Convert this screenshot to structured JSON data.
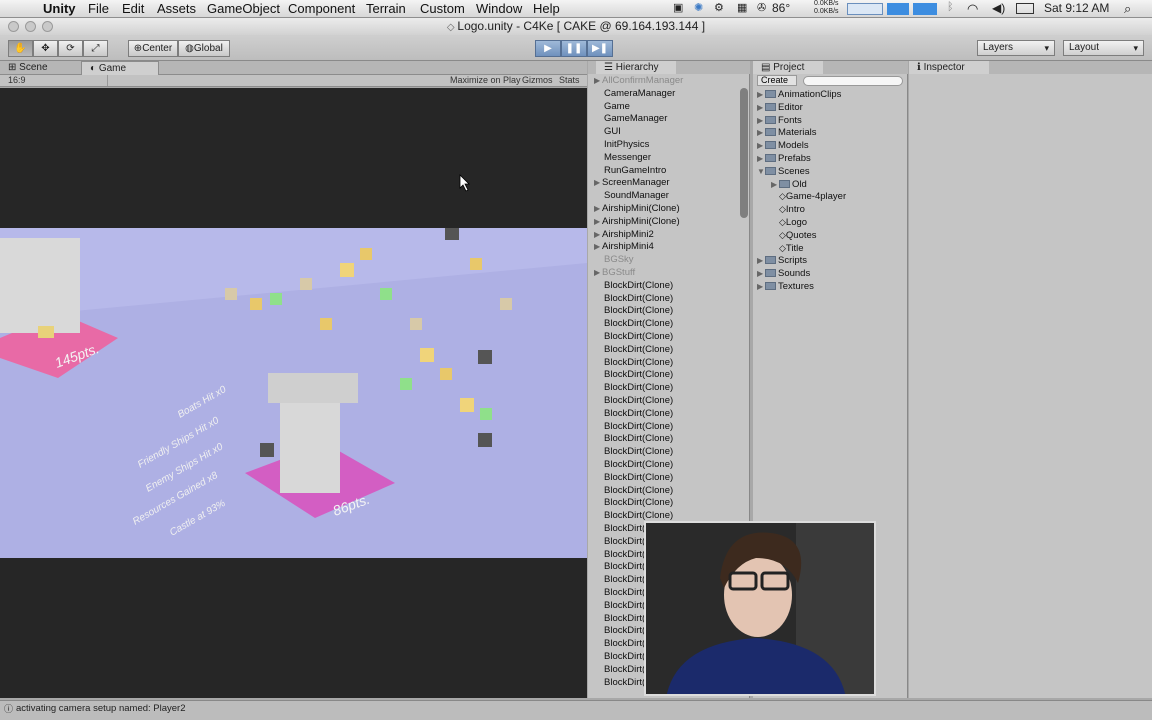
{
  "menubar": {
    "app": "Unity",
    "items": [
      "File",
      "Edit",
      "Assets",
      "GameObject",
      "Component",
      "Terrain",
      "Custom",
      "Window",
      "Help"
    ],
    "temperature": "86°",
    "net_up": "0.0KB/s",
    "net_down": "0.0KB/s",
    "clock": "Sat 9:12 AM"
  },
  "window": {
    "title": "Logo.unity - C4Ke [ CAKE @ 69.164.193.144 ]"
  },
  "toolbar": {
    "pivot_label": "Center",
    "space_label": "Global",
    "play_icon": "play-icon",
    "pause_icon": "pause-icon",
    "step_icon": "step-icon",
    "layers_label": "Layers",
    "layout_label": "Layout"
  },
  "game_panel": {
    "tabs": [
      "Scene",
      "Game"
    ],
    "aspect": "16:9",
    "maximize_label": "Maximize on Play",
    "gizmos_label": "Gizmos",
    "stats_label": "Stats",
    "overlay": {
      "score_left": "145pts.",
      "score_right": "86pts.",
      "stats_lines": [
        "Boats Hit x0",
        "Friendly Ships Hit x0",
        "Enemy Ships Hit x0",
        "Resources Gained x8",
        "Castle at 93%"
      ]
    }
  },
  "hierarchy": {
    "title": "Hierarchy",
    "items": [
      {
        "label": "AllConfirmManager",
        "dim": true,
        "arrow": true
      },
      {
        "label": "CameraManager",
        "dim": false,
        "arrow": false
      },
      {
        "label": "Game",
        "dim": false,
        "arrow": false
      },
      {
        "label": "GameManager",
        "dim": false,
        "arrow": false
      },
      {
        "label": "GUI",
        "dim": false,
        "arrow": false
      },
      {
        "label": "InitPhysics",
        "dim": false,
        "arrow": false
      },
      {
        "label": "Messenger",
        "dim": false,
        "arrow": false
      },
      {
        "label": "RunGameIntro",
        "dim": false,
        "arrow": false
      },
      {
        "label": "ScreenManager",
        "dim": false,
        "arrow": true
      },
      {
        "label": "SoundManager",
        "dim": false,
        "arrow": false
      },
      {
        "label": "AirshipMini(Clone)",
        "dim": false,
        "arrow": true
      },
      {
        "label": "AirshipMini(Clone)",
        "dim": false,
        "arrow": true
      },
      {
        "label": "AirshipMini2",
        "dim": false,
        "arrow": true
      },
      {
        "label": "AirshipMini4",
        "dim": false,
        "arrow": true
      },
      {
        "label": "BGSky",
        "dim": true,
        "arrow": false
      },
      {
        "label": "BGStuff",
        "dim": true,
        "arrow": true
      },
      {
        "label": "BlockDirt(Clone)",
        "dim": false,
        "arrow": false
      },
      {
        "label": "BlockDirt(Clone)",
        "dim": false,
        "arrow": false
      },
      {
        "label": "BlockDirt(Clone)",
        "dim": false,
        "arrow": false
      },
      {
        "label": "BlockDirt(Clone)",
        "dim": false,
        "arrow": false
      },
      {
        "label": "BlockDirt(Clone)",
        "dim": false,
        "arrow": false
      },
      {
        "label": "BlockDirt(Clone)",
        "dim": false,
        "arrow": false
      },
      {
        "label": "BlockDirt(Clone)",
        "dim": false,
        "arrow": false
      },
      {
        "label": "BlockDirt(Clone)",
        "dim": false,
        "arrow": false
      },
      {
        "label": "BlockDirt(Clone)",
        "dim": false,
        "arrow": false
      },
      {
        "label": "BlockDirt(Clone)",
        "dim": false,
        "arrow": false
      },
      {
        "label": "BlockDirt(Clone)",
        "dim": false,
        "arrow": false
      },
      {
        "label": "BlockDirt(Clone)",
        "dim": false,
        "arrow": false
      },
      {
        "label": "BlockDirt(Clone)",
        "dim": false,
        "arrow": false
      },
      {
        "label": "BlockDirt(Clone)",
        "dim": false,
        "arrow": false
      },
      {
        "label": "BlockDirt(Clone)",
        "dim": false,
        "arrow": false
      },
      {
        "label": "BlockDirt(Clone)",
        "dim": false,
        "arrow": false
      },
      {
        "label": "BlockDirt(Clone)",
        "dim": false,
        "arrow": false
      },
      {
        "label": "BlockDirt(Clone)",
        "dim": false,
        "arrow": false
      },
      {
        "label": "BlockDirt(Clone)",
        "dim": false,
        "arrow": false
      },
      {
        "label": "BlockDirt(Clone)",
        "dim": false,
        "arrow": false
      },
      {
        "label": "BlockDirt(Clone)",
        "dim": false,
        "arrow": false
      },
      {
        "label": "BlockDirt(Clone)",
        "dim": false,
        "arrow": false
      },
      {
        "label": "BlockDirt(Clone)",
        "dim": false,
        "arrow": false
      },
      {
        "label": "BlockDirt(Clone)",
        "dim": false,
        "arrow": false
      },
      {
        "label": "BlockDirt(Clone)",
        "dim": false,
        "arrow": false
      },
      {
        "label": "BlockDirt(Clone)",
        "dim": false,
        "arrow": false
      },
      {
        "label": "BlockDirt(Clone)",
        "dim": false,
        "arrow": false
      },
      {
        "label": "BlockDirt(Clone)",
        "dim": false,
        "arrow": false
      },
      {
        "label": "BlockDirt(Clone)",
        "dim": false,
        "arrow": false
      },
      {
        "label": "BlockDirt(Clone)",
        "dim": false,
        "arrow": false
      },
      {
        "label": "BlockDirt(Clone)",
        "dim": false,
        "arrow": false
      },
      {
        "label": "BlockDirt(Clone)",
        "dim": false,
        "arrow": false
      }
    ]
  },
  "project": {
    "title": "Project",
    "create_label": "Create",
    "items": [
      {
        "label": "AnimationClips",
        "kind": "folder",
        "level": 0,
        "arrow": "▶"
      },
      {
        "label": "Editor",
        "kind": "folder",
        "level": 0,
        "arrow": "▶"
      },
      {
        "label": "Fonts",
        "kind": "folder",
        "level": 0,
        "arrow": "▶"
      },
      {
        "label": "Materials",
        "kind": "folder",
        "level": 0,
        "arrow": "▶"
      },
      {
        "label": "Models",
        "kind": "folder",
        "level": 0,
        "arrow": "▶"
      },
      {
        "label": "Prefabs",
        "kind": "folder",
        "level": 0,
        "arrow": "▶"
      },
      {
        "label": "Scenes",
        "kind": "folder",
        "level": 0,
        "arrow": "▼"
      },
      {
        "label": "Old",
        "kind": "folder",
        "level": 1,
        "arrow": "▶"
      },
      {
        "label": "Game-4player",
        "kind": "scene",
        "level": 1,
        "arrow": ""
      },
      {
        "label": "Intro",
        "kind": "scene",
        "level": 1,
        "arrow": ""
      },
      {
        "label": "Logo",
        "kind": "scene",
        "level": 1,
        "arrow": ""
      },
      {
        "label": "Quotes",
        "kind": "scene",
        "level": 1,
        "arrow": ""
      },
      {
        "label": "Title",
        "kind": "scene",
        "level": 1,
        "arrow": ""
      },
      {
        "label": "Scripts",
        "kind": "folder",
        "level": 0,
        "arrow": "▶"
      },
      {
        "label": "Sounds",
        "kind": "folder",
        "level": 0,
        "arrow": "▶"
      },
      {
        "label": "Textures",
        "kind": "folder",
        "level": 0,
        "arrow": "▶"
      }
    ]
  },
  "inspector": {
    "title": "Inspector"
  },
  "statusbar": {
    "message": "activating camera setup named: Player2"
  }
}
